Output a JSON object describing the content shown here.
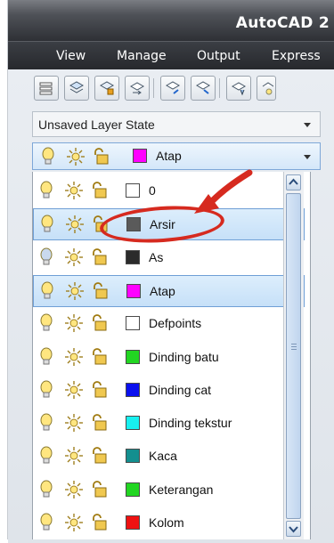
{
  "app": {
    "title": "AutoCAD 2"
  },
  "menu": [
    "View",
    "Manage",
    "Output",
    "Express"
  ],
  "toolbar_icons": [
    "layer-properties-icon",
    "set-current-layer-icon",
    "layer-state-icon",
    "match-layer-icon",
    "previous-layer-icon",
    "isolate-layer-icon",
    "freeze-layer-icon",
    "off-layer-icon"
  ],
  "layer_state": {
    "value": "Unsaved Layer State"
  },
  "current_layer": {
    "name": "Atap",
    "color": "#ff00ff"
  },
  "layers": [
    {
      "name": "0",
      "color": "#ffffff",
      "bulb": "#ffe680"
    },
    {
      "name": "Arsir",
      "color": "#5a5a5a",
      "bulb": "#ffe680",
      "selected": true
    },
    {
      "name": "As",
      "color": "#2b2b2b",
      "bulb": "#c9d9ee"
    },
    {
      "name": "Atap",
      "color": "#ff00ff",
      "bulb": "#ffe680",
      "selected": true
    },
    {
      "name": "Defpoints",
      "color": "#ffffff",
      "bulb": "#ffe680"
    },
    {
      "name": "Dinding batu",
      "color": "#22d622",
      "bulb": "#ffe680"
    },
    {
      "name": "Dinding cat",
      "color": "#0a10ee",
      "bulb": "#ffe680"
    },
    {
      "name": "Dinding tekstur",
      "color": "#18f0f0",
      "bulb": "#ffe680"
    },
    {
      "name": "Kaca",
      "color": "#138f8f",
      "bulb": "#ffe680"
    },
    {
      "name": "Keterangan",
      "color": "#22d622",
      "bulb": "#ffe680"
    },
    {
      "name": "Kolom",
      "color": "#ee1111",
      "bulb": "#ffe680"
    }
  ],
  "colors": {
    "annotation": "#d62a1f",
    "selection": "#6f9fd6"
  }
}
